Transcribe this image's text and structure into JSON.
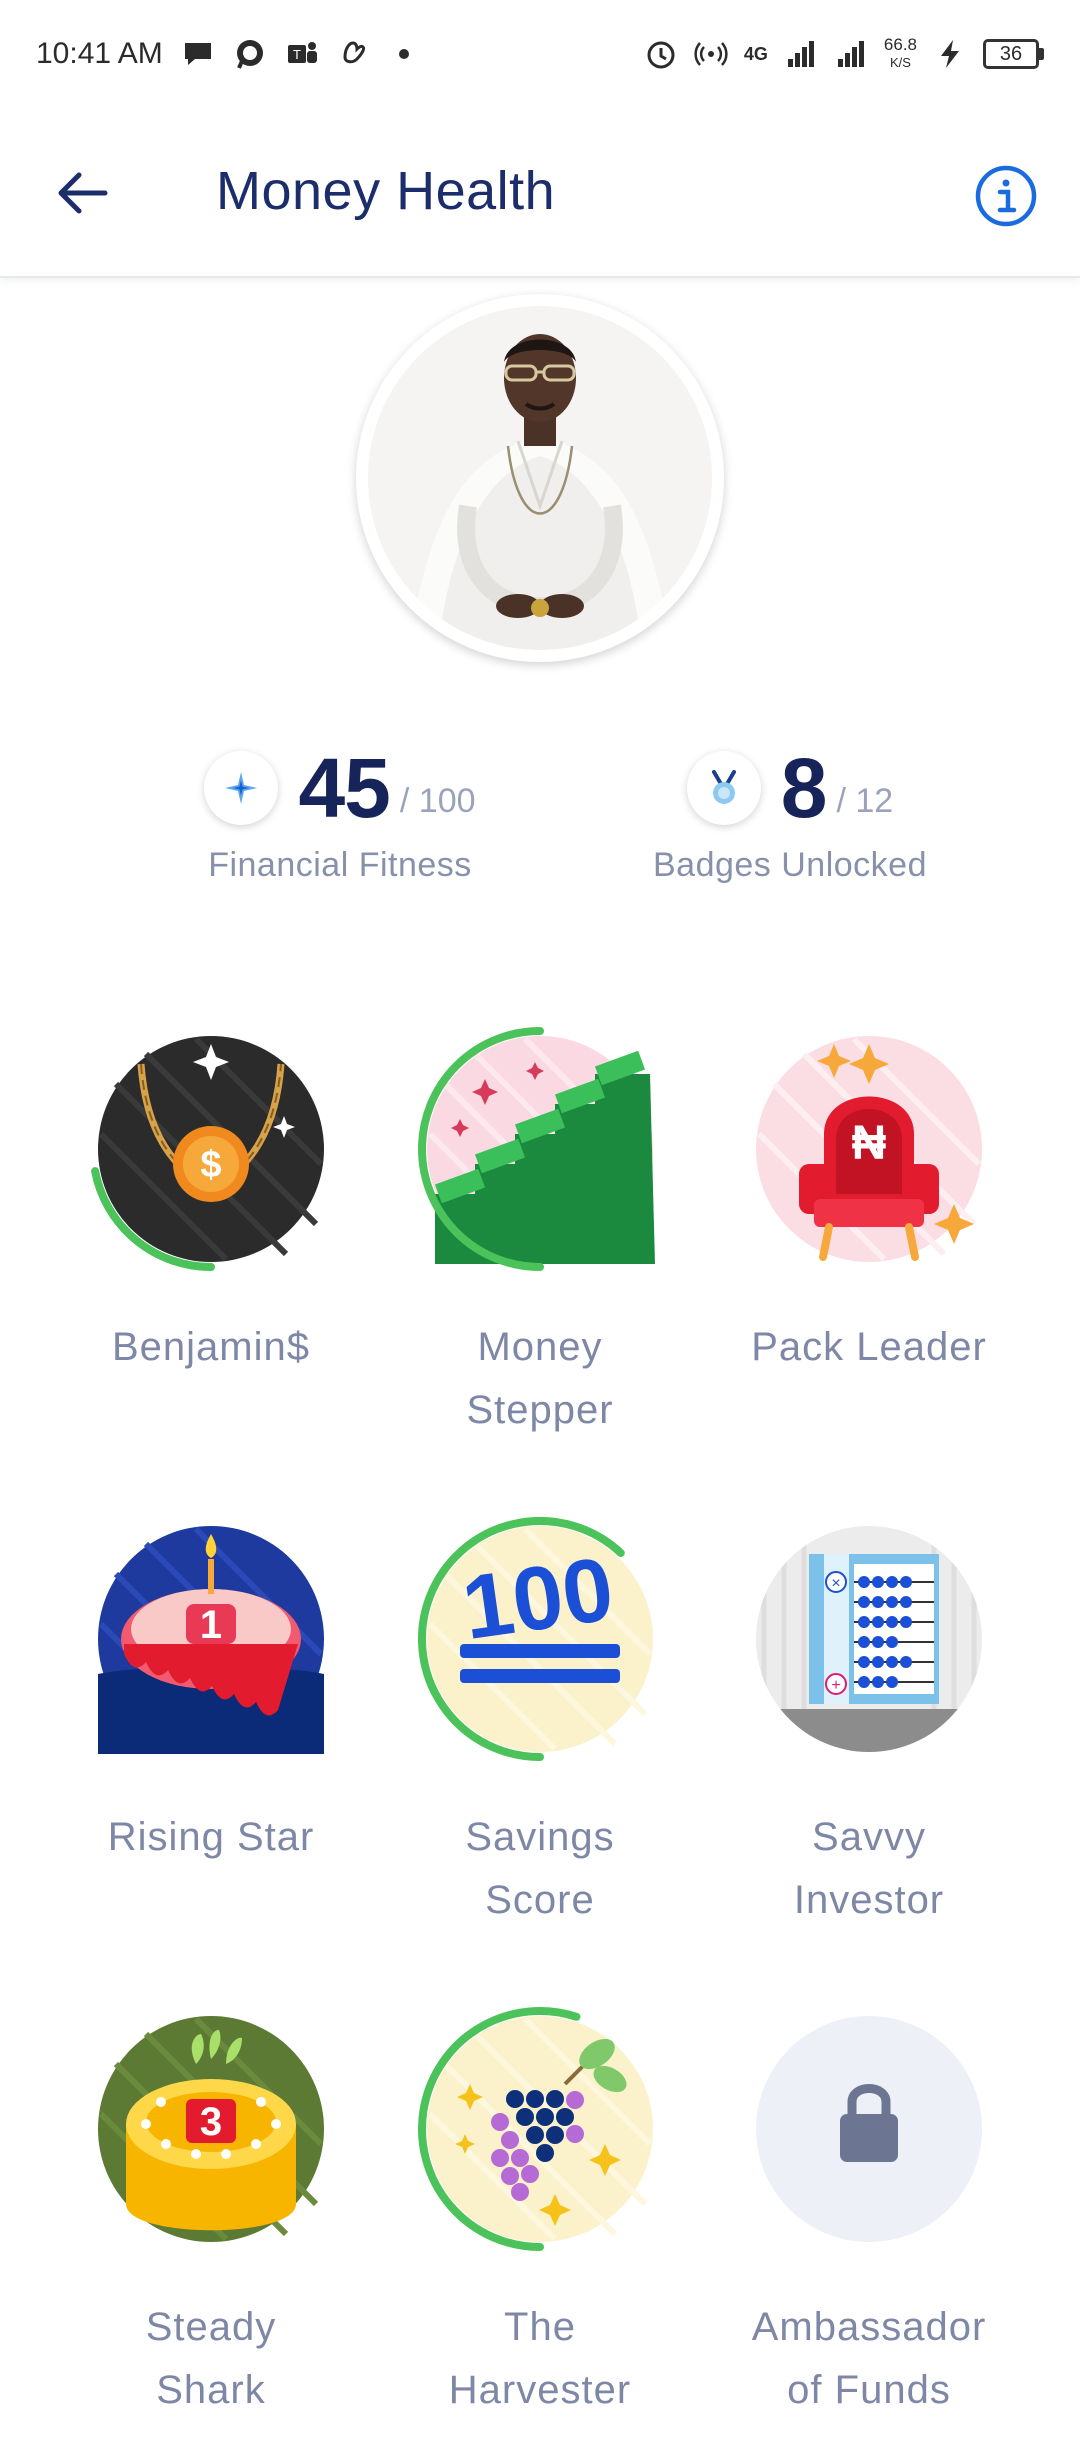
{
  "status_bar": {
    "time": "10:41 AM",
    "network_type": "4G",
    "speed_value": "66.8",
    "speed_unit": "K/S",
    "battery_level": "36"
  },
  "header": {
    "title": "Money Health"
  },
  "stats": {
    "financial_fitness": {
      "value": "45",
      "total": "/ 100",
      "label": "Financial Fitness"
    },
    "badges_unlocked": {
      "value": "8",
      "total": "/ 12",
      "label": "Badges Unlocked"
    }
  },
  "badges": [
    {
      "name": "Benjamin$",
      "line2": "",
      "locked": false,
      "progress": 0.22
    },
    {
      "name": "Money",
      "line2": "Stepper",
      "locked": false,
      "progress": 0.5
    },
    {
      "name": "Pack Leader",
      "line2": "",
      "locked": false,
      "progress": 0
    },
    {
      "name": "Rising Star",
      "line2": "",
      "locked": false,
      "progress": 0
    },
    {
      "name": "Savings",
      "line2": "Score",
      "locked": false,
      "progress": 0.62
    },
    {
      "name": "Savvy",
      "line2": "Investor",
      "locked": false,
      "progress": 0
    },
    {
      "name": "Steady",
      "line2": "Shark",
      "locked": false,
      "progress": 0
    },
    {
      "name": "The",
      "line2": "Harvester",
      "locked": false,
      "progress": 0.55
    },
    {
      "name": "Ambassador",
      "line2": "of Funds",
      "locked": true,
      "progress": 0
    }
  ],
  "colors": {
    "title": "#1c2d6b",
    "accent_blue": "#1a6be0",
    "progress_green": "#4cc35a",
    "label_gray": "#7e88a6"
  },
  "icons": {
    "back": "arrow-left-icon",
    "info": "info-circle-icon",
    "fitness": "sparkle-icon",
    "badges": "medal-icon",
    "locked": "lock-icon"
  }
}
